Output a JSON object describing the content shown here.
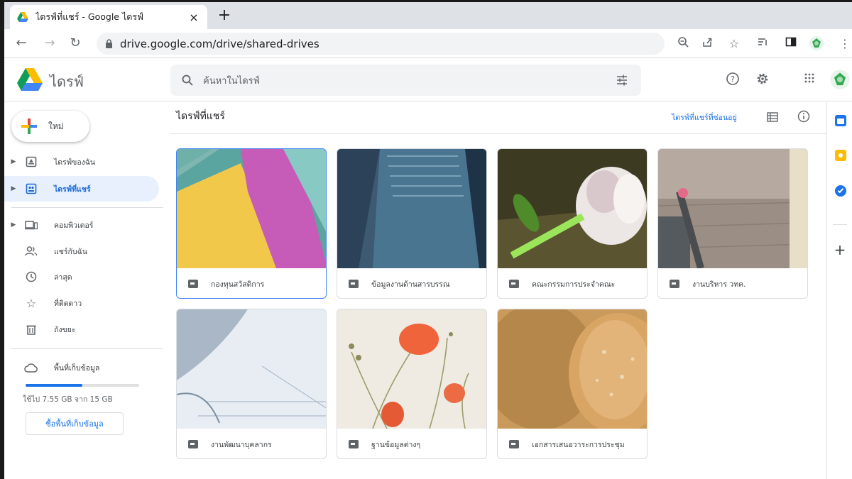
{
  "browser": {
    "tab_title": "ไดรฟ์ที่แชร์ - Google ไดรฟ์",
    "tab_close": "×",
    "new_tab": "+",
    "url": "drive.google.com/drive/shared-drives"
  },
  "header": {
    "app_name": "ไดรฟ์",
    "search_placeholder": "ค้นหาในไดรฟ์"
  },
  "sidebar": {
    "new_label": "ใหม่",
    "items": [
      {
        "label": "ไดรฟ์ของฉัน",
        "icon": "my-drive-icon"
      },
      {
        "label": "ไดรฟ์ที่แชร์",
        "icon": "shared-drives-icon"
      },
      {
        "label": "คอมพิวเตอร์",
        "icon": "computer-icon"
      },
      {
        "label": "แชร์กับฉัน",
        "icon": "people-icon"
      },
      {
        "label": "ล่าสุด",
        "icon": "clock-icon"
      },
      {
        "label": "ที่ติดดาว",
        "icon": "star-icon"
      },
      {
        "label": "ถังขยะ",
        "icon": "trash-icon"
      }
    ],
    "storage_label": "พื้นที่เก็บข้อมูล",
    "storage_used_text": "ใช้ไป 7.55 GB จาก 15 GB",
    "storage_fraction": 0.503,
    "buy_storage_label": "ซื้อพื้นที่เก็บข้อมูล"
  },
  "main": {
    "title": "ไดรฟ์ที่แชร์",
    "hidden_drives_link": "ไดรฟ์ที่แชร์ที่ซ่อนอยู่",
    "drives": [
      {
        "name": "กองทุนสวัสดิการ"
      },
      {
        "name": "ข้อมูลงานด้านสารบรรณ"
      },
      {
        "name": "คณะกรรมการประจำคณะ"
      },
      {
        "name": "งานบริหาร วทค."
      },
      {
        "name": "งานพัฒนาบุคลากร"
      },
      {
        "name": "ฐานข้อมูลต่างๆ"
      },
      {
        "name": "เอกสารเสนอวาระการประชุม"
      }
    ]
  },
  "colors": {
    "accent": "#1a73e8",
    "active_nav_bg": "#e8f0fe"
  }
}
